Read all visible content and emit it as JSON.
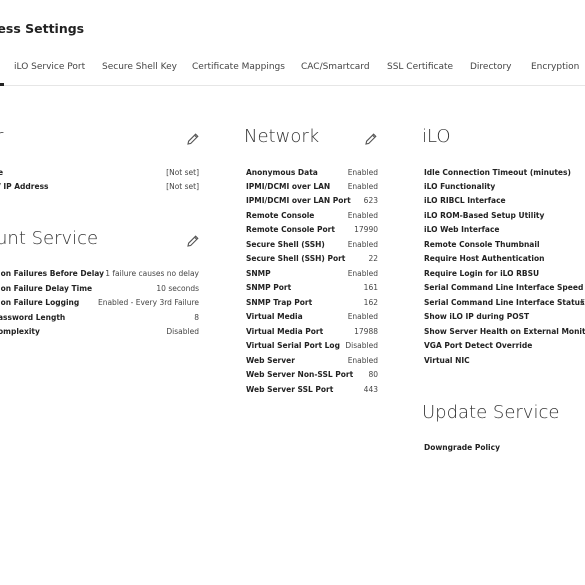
{
  "page": {
    "title": "cess Settings"
  },
  "tabs": [
    {
      "label": "iLO Service Port"
    },
    {
      "label": "Secure Shell Key"
    },
    {
      "label": "Certificate Mappings"
    },
    {
      "label": "CAC/Smartcard"
    },
    {
      "label": "SSL Certificate"
    },
    {
      "label": "Directory"
    },
    {
      "label": "Encryption"
    }
  ],
  "left_top": {
    "title": "r",
    "rows": [
      {
        "label": "e",
        "value": "[Not set]"
      },
      {
        "label": "/ IP Address",
        "value": "[Not set]"
      }
    ]
  },
  "account_service": {
    "title": "unt Service",
    "rows": [
      {
        "label": "ion Failures Before Delay",
        "value": "1 failure causes no delay"
      },
      {
        "label": "ion Failure Delay Time",
        "value": "10 seconds"
      },
      {
        "label": "ion Failure Logging",
        "value": "Enabled - Every 3rd Failure"
      },
      {
        "label": "assword Length",
        "value": "8"
      },
      {
        "label": "omplexity",
        "value": "Disabled"
      }
    ]
  },
  "network": {
    "title": "Network",
    "rows": [
      {
        "label": "Anonymous Data",
        "value": "Enabled"
      },
      {
        "label": "IPMI/DCMI over LAN",
        "value": "Enabled"
      },
      {
        "label": "IPMI/DCMI over LAN Port",
        "value": "623"
      },
      {
        "label": "Remote Console",
        "value": "Enabled"
      },
      {
        "label": "Remote Console Port",
        "value": "17990"
      },
      {
        "label": "Secure Shell (SSH)",
        "value": "Enabled"
      },
      {
        "label": "Secure Shell (SSH) Port",
        "value": "22"
      },
      {
        "label": "SNMP",
        "value": "Enabled"
      },
      {
        "label": "SNMP Port",
        "value": "161"
      },
      {
        "label": "SNMP Trap Port",
        "value": "162"
      },
      {
        "label": "Virtual Media",
        "value": "Enabled"
      },
      {
        "label": "Virtual Media Port",
        "value": "17988"
      },
      {
        "label": "Virtual Serial Port Log",
        "value": "Disabled"
      },
      {
        "label": "Web Server",
        "value": "Enabled"
      },
      {
        "label": "Web Server Non-SSL Port",
        "value": "80"
      },
      {
        "label": "Web Server SSL Port",
        "value": "443"
      }
    ]
  },
  "ilo": {
    "title": "iLO",
    "rows": [
      {
        "label": "Idle Connection Timeout (minutes)",
        "value": ""
      },
      {
        "label": "iLO Functionality",
        "value": ""
      },
      {
        "label": "iLO RIBCL Interface",
        "value": ""
      },
      {
        "label": "iLO ROM-Based Setup Utility",
        "value": ""
      },
      {
        "label": "iLO Web Interface",
        "value": ""
      },
      {
        "label": "Remote Console Thumbnail",
        "value": ""
      },
      {
        "label": "Require Host Authentication",
        "value": ""
      },
      {
        "label": "Require Login for iLO RBSU",
        "value": ""
      },
      {
        "label": "Serial Command Line Interface Speed",
        "value": ""
      },
      {
        "label": "Serial Command Line Interface Status",
        "value": "E"
      },
      {
        "label": "Show iLO IP during POST",
        "value": ""
      },
      {
        "label": "Show Server Health on External Monitor",
        "value": ""
      },
      {
        "label": "VGA Port Detect Override",
        "value": ""
      },
      {
        "label": "Virtual NIC",
        "value": ""
      }
    ]
  },
  "update_service": {
    "title": "Update Service",
    "rows": [
      {
        "label": "Downgrade Policy",
        "value": ""
      }
    ]
  }
}
